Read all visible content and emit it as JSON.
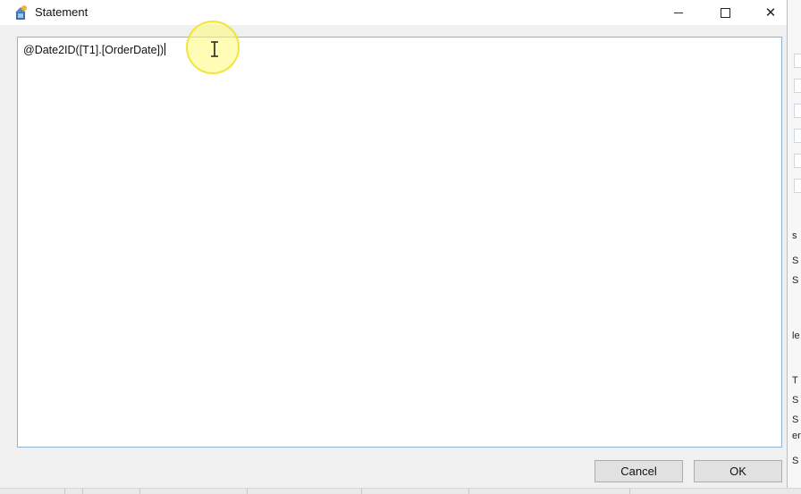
{
  "window": {
    "title": "Statement",
    "controls": {
      "minimize_icon": "minimize-icon",
      "maximize_icon": "maximize-icon",
      "close_glyph": "✕"
    }
  },
  "editor": {
    "text": "@Date2ID([T1].[OrderDate])"
  },
  "buttons": {
    "cancel_label": "Cancel",
    "ok_label": "OK"
  },
  "background": {
    "chars": [
      "s",
      "S",
      "S",
      "le",
      "T",
      "S",
      "S",
      "er",
      "S"
    ]
  },
  "colors": {
    "editor_border": "#8db2d6",
    "cursor_highlight": "#fffa78"
  }
}
